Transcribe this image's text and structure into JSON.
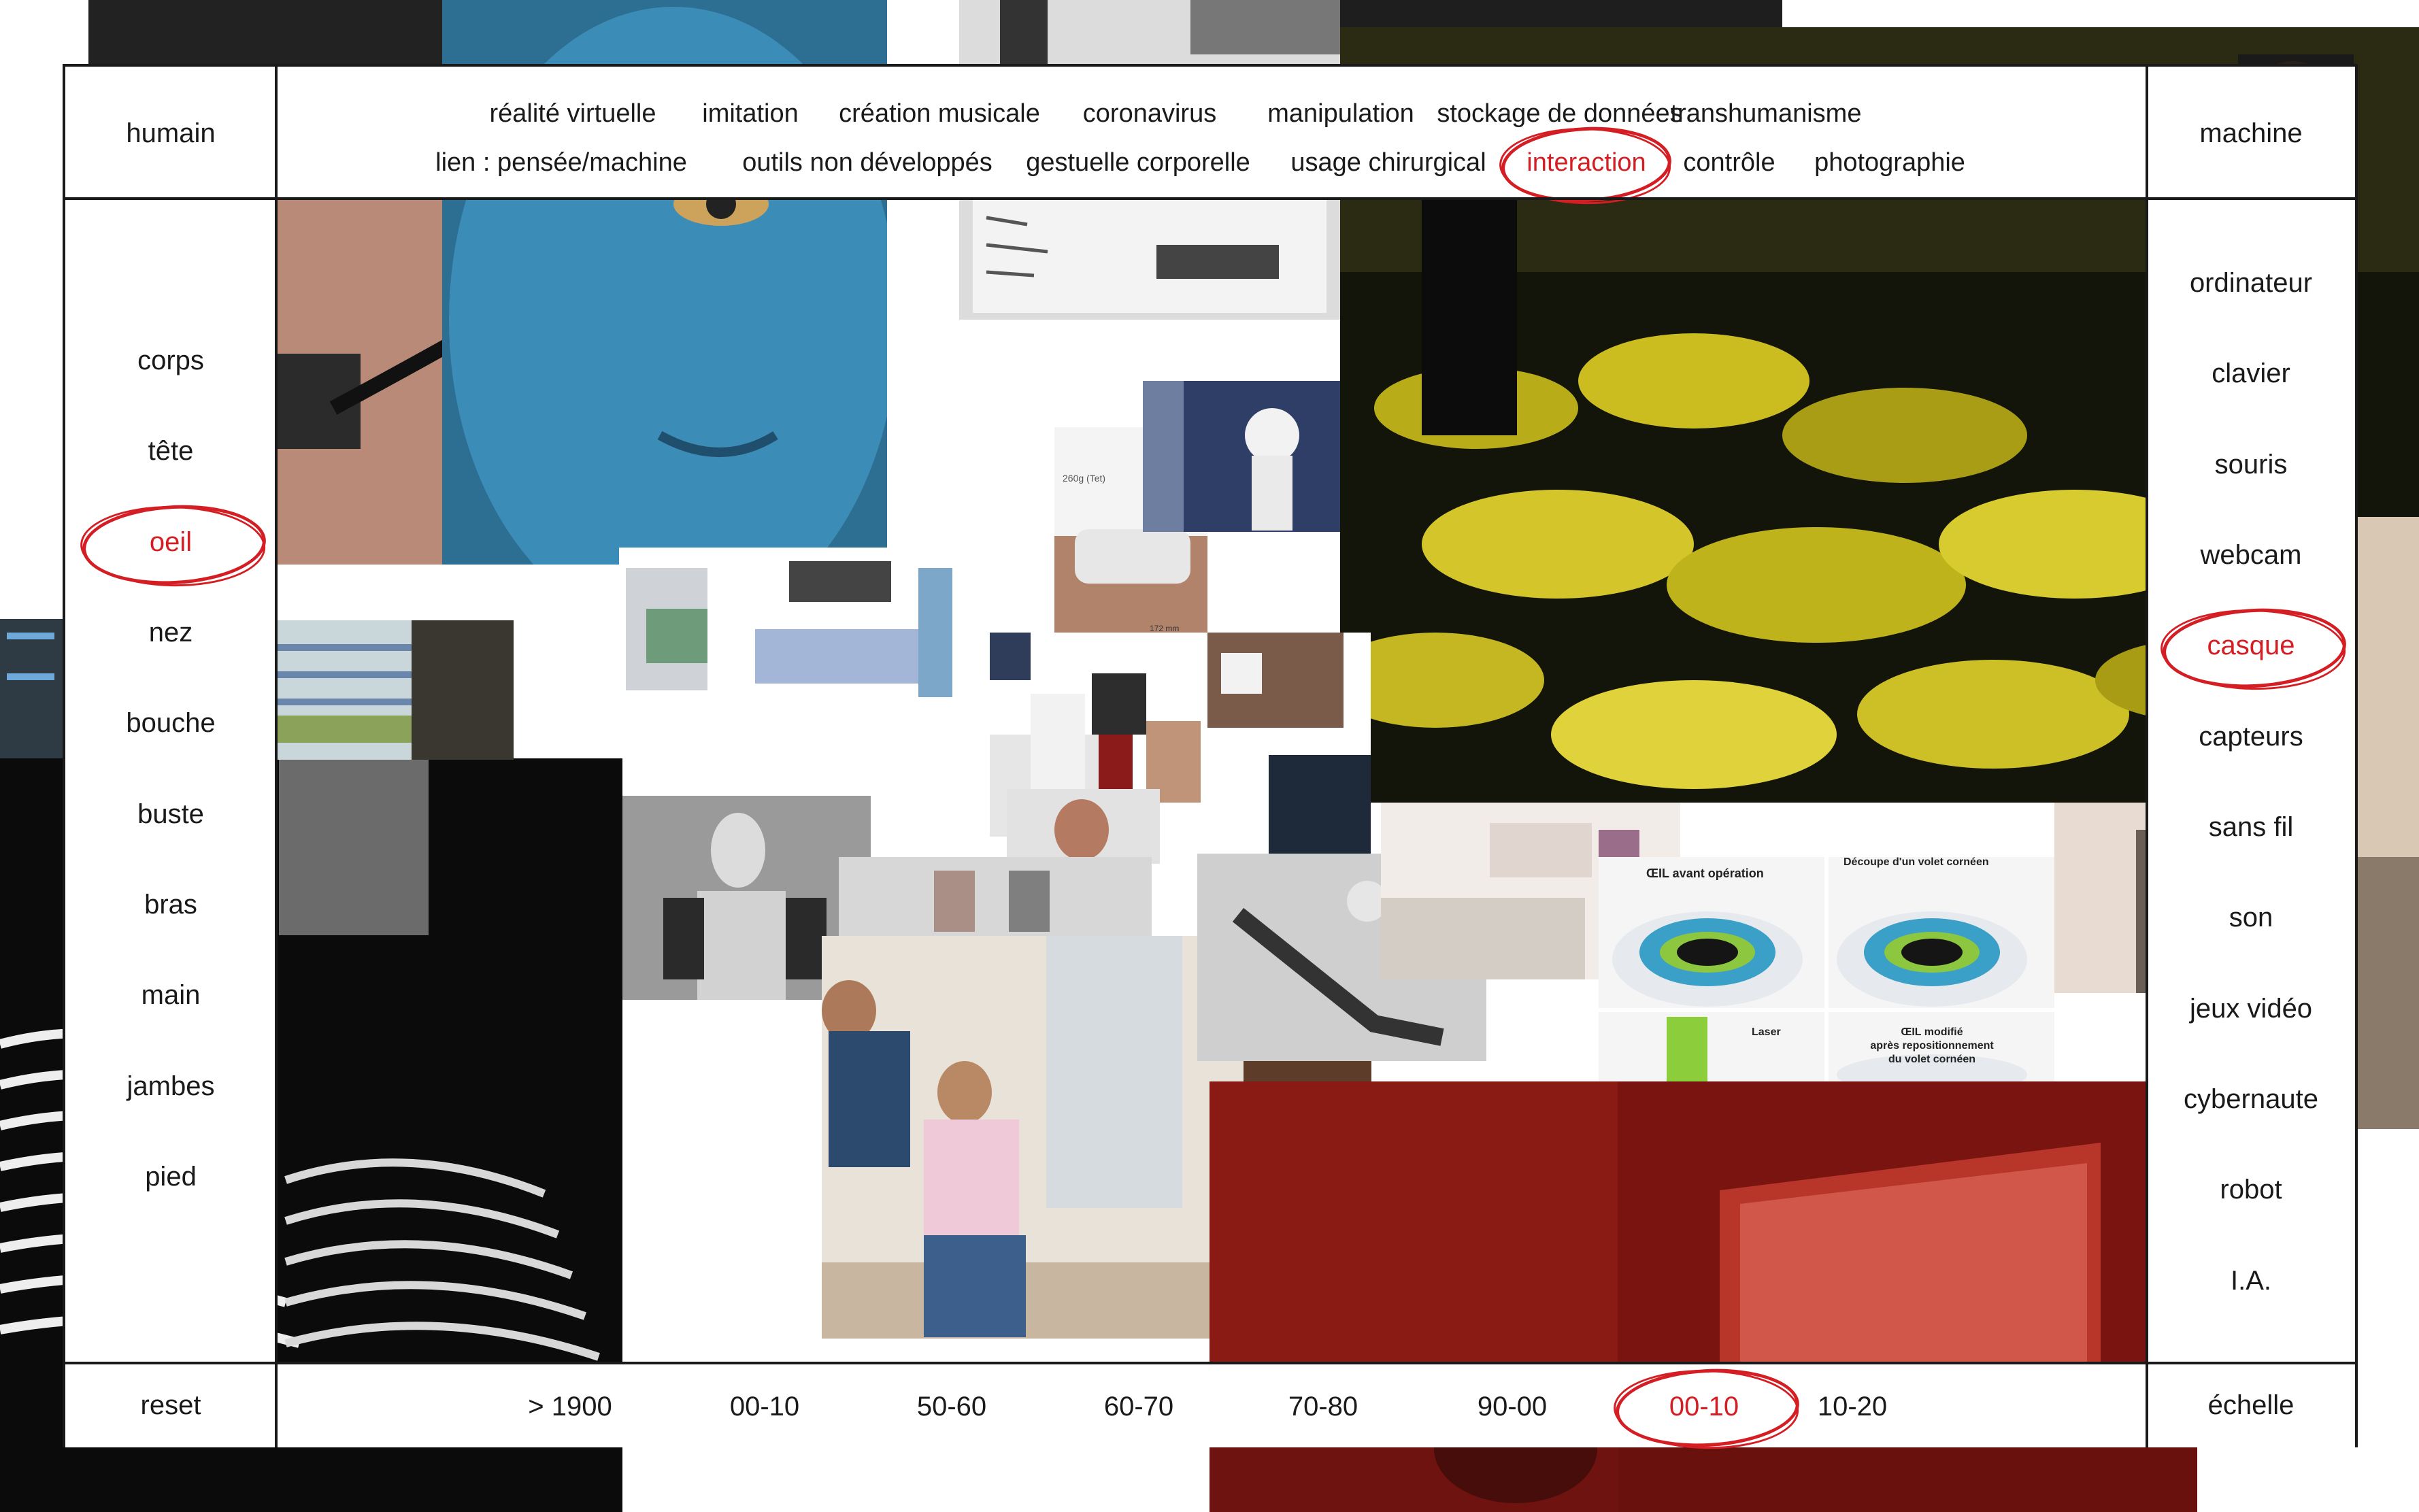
{
  "header": {
    "left_label": "humain",
    "right_label": "machine",
    "topics_row1": [
      "réalité virtuelle",
      "imitation",
      "création musicale",
      "coronavirus",
      "manipulation",
      "stockage de données",
      "transhumanisme"
    ],
    "topics_row2": [
      "lien : pensée/machine",
      "outils non développés",
      "gestuelle corporelle",
      "usage chirurgical",
      "interaction",
      "contrôle",
      "photographie"
    ],
    "selected_topic": "interaction"
  },
  "left_sidebar": {
    "items": [
      "corps",
      "tête",
      "oeil",
      "nez",
      "bouche",
      "buste",
      "bras",
      "main",
      "jambes",
      "pied"
    ],
    "selected": "oeil"
  },
  "right_sidebar": {
    "items": [
      "ordinateur",
      "clavier",
      "souris",
      "webcam",
      "casque",
      "capteurs",
      "sans fil",
      "son",
      "jeux vidéo",
      "cybernaute",
      "robot",
      "I.A."
    ],
    "selected": "casque"
  },
  "footer": {
    "left_label": "reset",
    "right_label": "échelle",
    "periods": [
      "> 1900",
      "00-10",
      "50-60",
      "60-70",
      "70-80",
      "90-00",
      "00-10",
      "10-20"
    ],
    "selected_period_index": 6
  },
  "images": {
    "eye_diagram": {
      "before": "ŒIL avant opération",
      "cut": "Découpe d'un volet cornéen",
      "laser": "Laser",
      "after_line1": "ŒIL modifié",
      "after_line2": "après repositionnement",
      "after_line3": "du volet cornéen"
    },
    "product_card": {
      "weight": "260g (Tet)",
      "size": "172 mm"
    }
  },
  "colors": {
    "accent_red": "#d41e24",
    "frame_line": "#1a1a1a"
  }
}
